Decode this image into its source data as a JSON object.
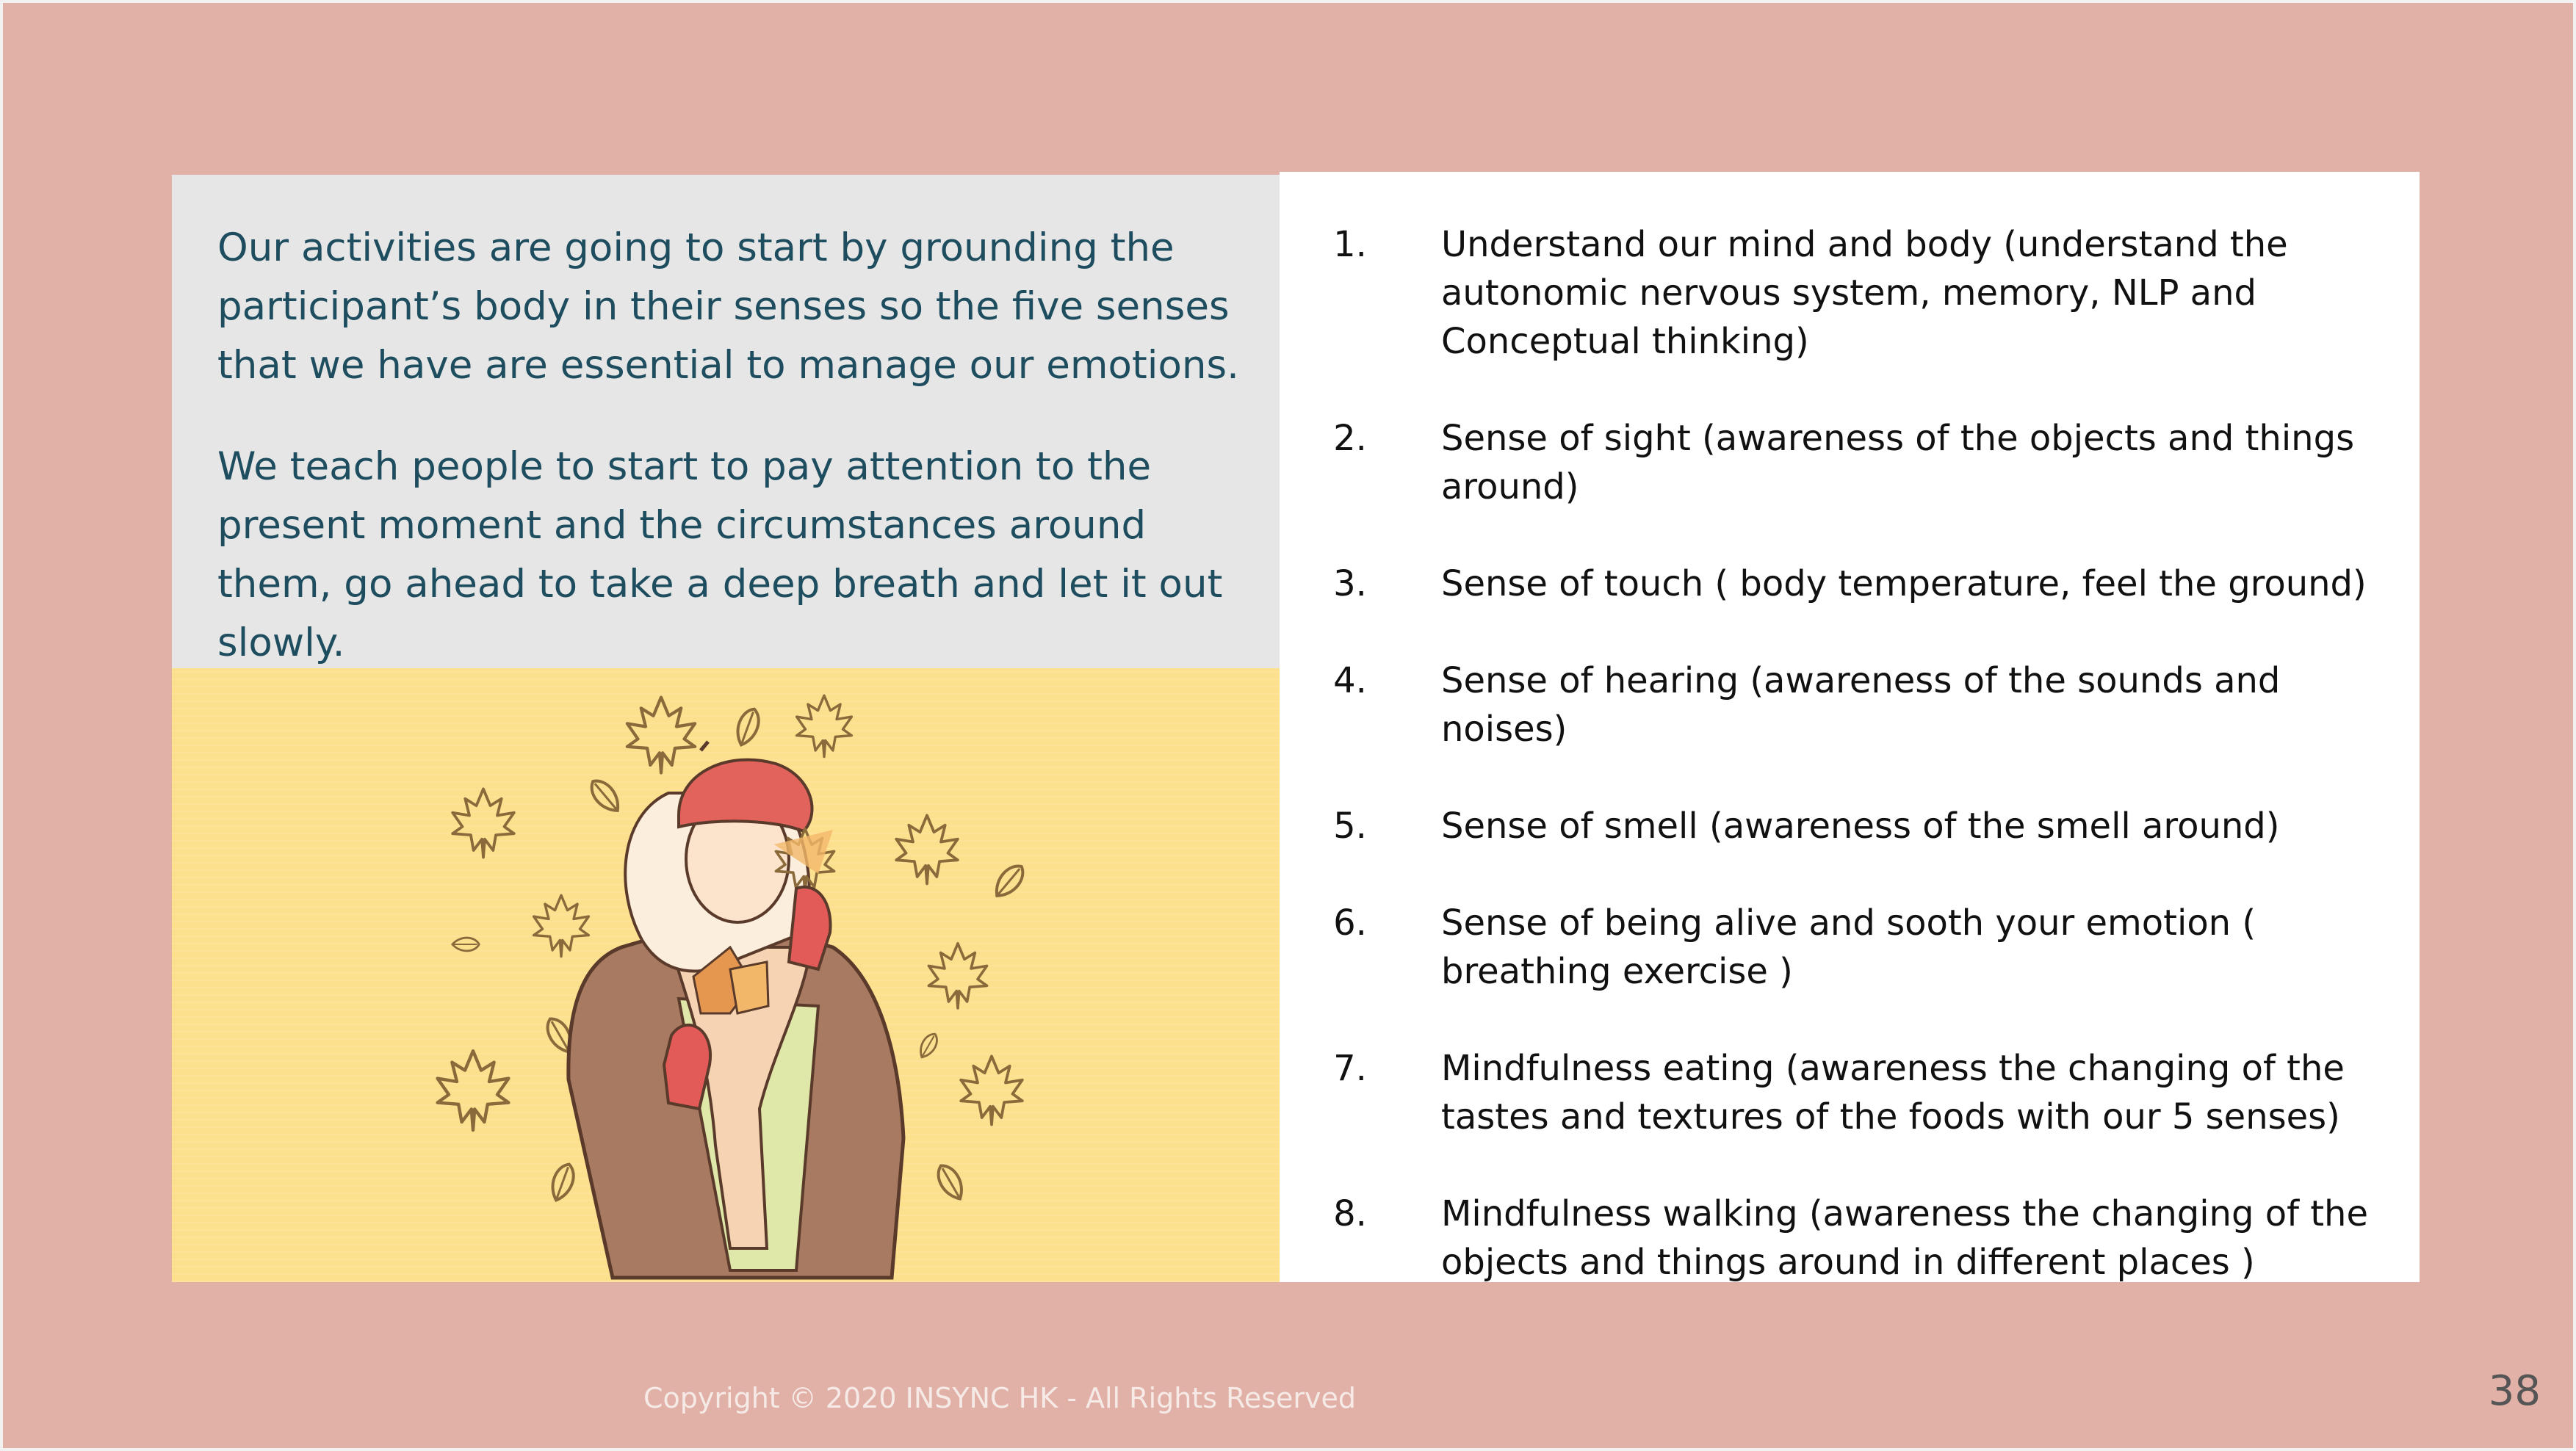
{
  "intro": {
    "paragraph1": "Our activities are going to start by grounding the participant’s body in their senses so the five senses that we have are essential to manage our emotions.",
    "paragraph2": "We teach people to start to pay attention to the present moment and the circumstances around them, go ahead to take a deep breath and let it out slowly."
  },
  "list": [
    {
      "num": "1.",
      "text": "Understand our mind and body (understand the autonomic nervous system, memory, NLP and Conceptual thinking)"
    },
    {
      "num": "2.",
      "text": "Sense of sight (awareness of the objects and things around)"
    },
    {
      "num": "3.",
      "text": "Sense of touch ( body temperature, feel the ground)"
    },
    {
      "num": "4.",
      "text": "Sense of hearing (awareness of the sounds and noises)"
    },
    {
      "num": "5.",
      "text": "Sense of smell (awareness of the smell around)"
    },
    {
      "num": "6.",
      "text": "Sense of being alive and sooth your emotion ( breathing exercise )"
    },
    {
      "num": "7.",
      "text": "Mindfulness eating (awareness the changing of the tastes and textures of the foods with our 5 senses)"
    },
    {
      "num": "8.",
      "text": "Mindfulness walking (awareness the changing of the objects and things around in different places )"
    }
  ],
  "footer": {
    "copyright": "Copyright © 2020 INSYNC HK - All Rights Reserved"
  },
  "page_number": "38",
  "colors": {
    "background": "#e1b1a8",
    "intro_box": "#e6e6e6",
    "intro_text": "#1d4d5e",
    "illustration_bg": "#fde08e",
    "list_panel": "#ffffff"
  }
}
